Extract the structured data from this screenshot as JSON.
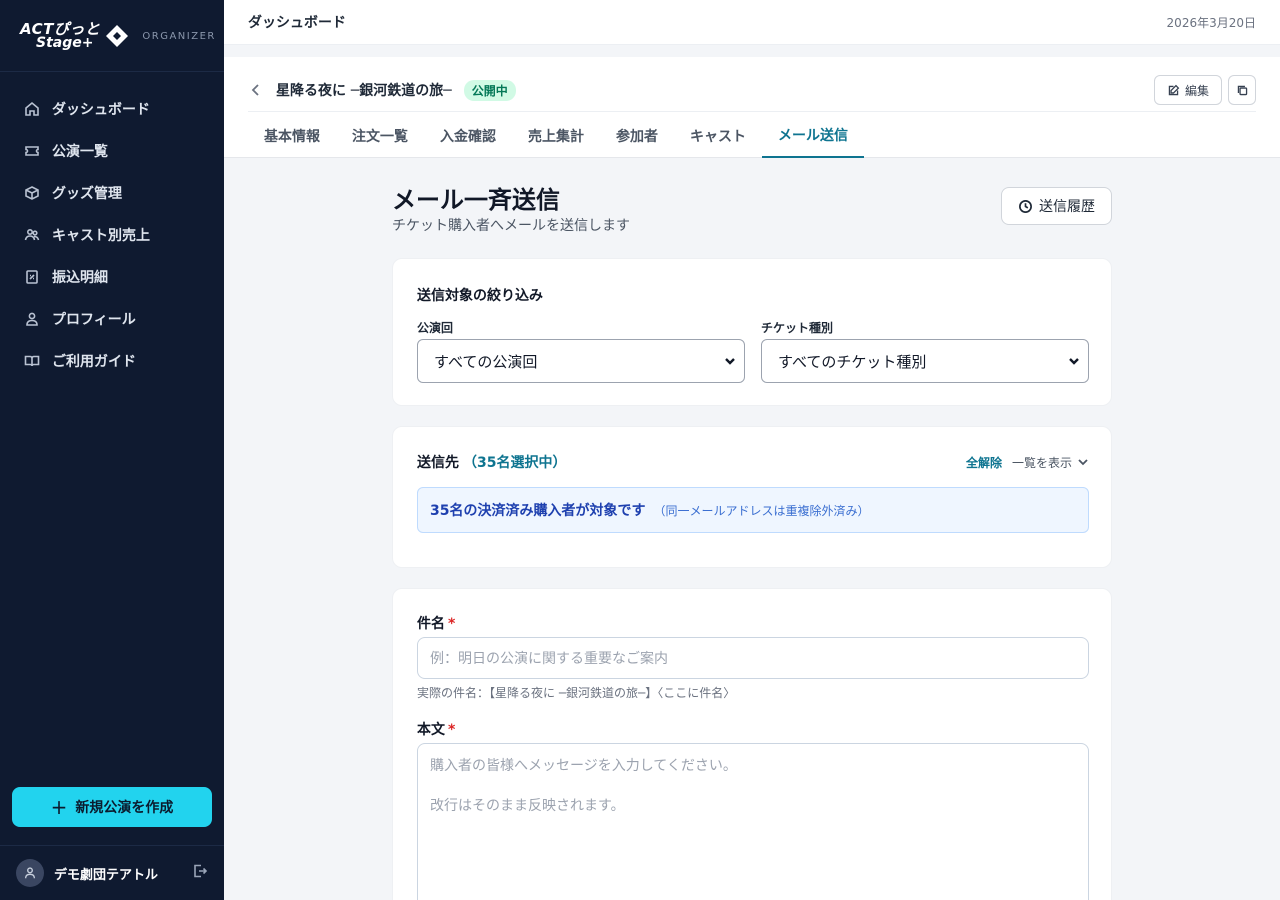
{
  "sidebar": {
    "brand_line1": "ACTぴっと",
    "brand_line2": "Stage+",
    "brand_org": "ORGANIZER",
    "items": [
      {
        "label": "ダッシュボード",
        "icon": "home-icon"
      },
      {
        "label": "公演一覧",
        "icon": "ticket-icon"
      },
      {
        "label": "グッズ管理",
        "icon": "box-icon"
      },
      {
        "label": "キャスト別売上",
        "icon": "users-icon"
      },
      {
        "label": "振込明細",
        "icon": "receipt-icon"
      },
      {
        "label": "プロフィール",
        "icon": "user-icon"
      },
      {
        "label": "ご利用ガイド",
        "icon": "book-icon"
      }
    ],
    "create_label": "新規公演を作成",
    "user_name": "デモ劇団テアトル"
  },
  "topbar": {
    "title": "ダッシュボード",
    "date": "2026年3月20日"
  },
  "event": {
    "title": "星降る夜に ─銀河鉄道の旅─",
    "status": "公開中",
    "edit_label": "編集"
  },
  "tabs": [
    {
      "label": "基本情報",
      "active": false
    },
    {
      "label": "注文一覧",
      "active": false
    },
    {
      "label": "入金確認",
      "active": false
    },
    {
      "label": "売上集計",
      "active": false
    },
    {
      "label": "参加者",
      "active": false
    },
    {
      "label": "キャスト",
      "active": false
    },
    {
      "label": "メール送信",
      "active": true
    }
  ],
  "page": {
    "title": "メール一斉送信",
    "subtitle": "チケット購入者へメールを送信します",
    "history_label": "送信履歴"
  },
  "filter": {
    "title": "送信対象の絞り込み",
    "performance_label": "公演回",
    "performance_value": "すべての公演回",
    "ticket_label": "チケット種別",
    "ticket_value": "すべてのチケット種別"
  },
  "recipients": {
    "title": "送信先",
    "count": "（35名選択中）",
    "clear_all": "全解除",
    "show_list": "一覧を表示",
    "info_main": "35名の決済済み購入者が対象です",
    "info_note": "（同一メールアドレスは重複除外済み）"
  },
  "compose": {
    "subject_label": "件名",
    "required_mark": "*",
    "subject_placeholder": "例：明日の公演に関する重要なご案内",
    "subject_hint": "実際の件名：【星降る夜に ─銀河鉄道の旅─】〈ここに件名〉",
    "body_label": "本文",
    "body_placeholder": "購入者の皆様へメッセージを入力してください。\n\n改行はそのまま反映されます。"
  },
  "colors": {
    "sidebar_bg": "#0f1a30",
    "accent": "#0e7490",
    "create_button": "#22d3ee",
    "status_badge_bg": "#d1fae5"
  }
}
